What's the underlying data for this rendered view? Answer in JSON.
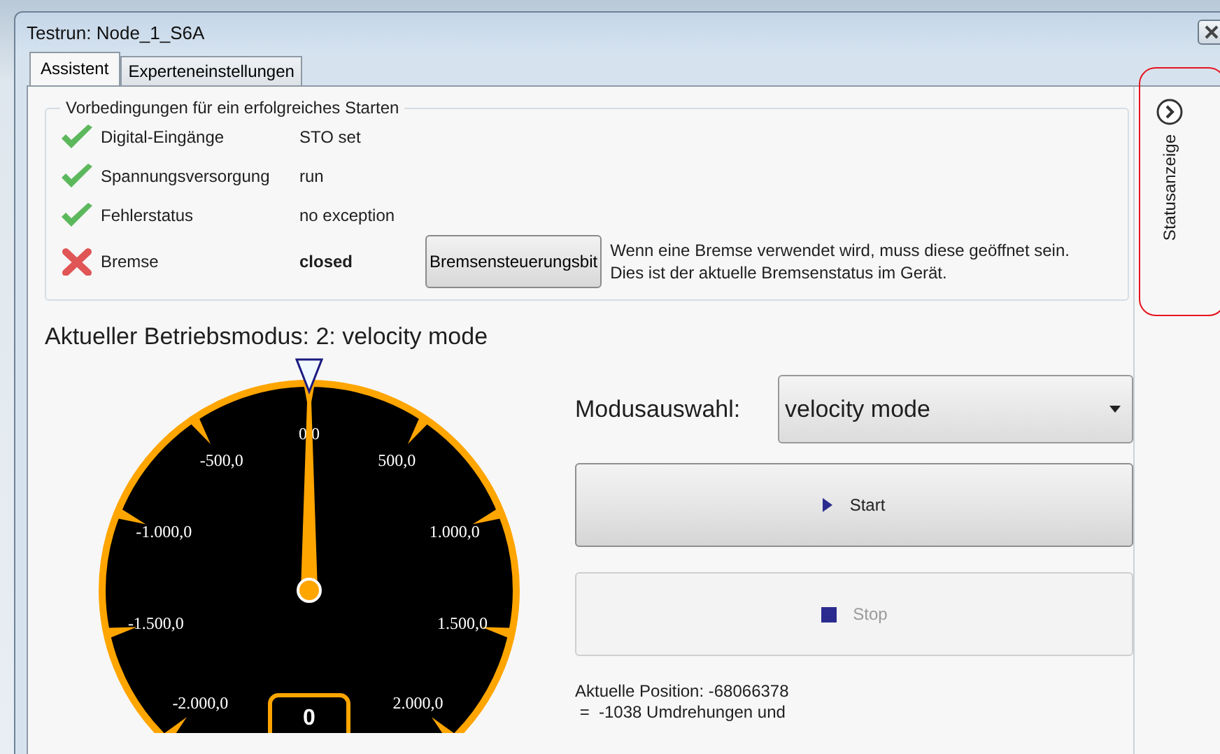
{
  "window": {
    "title": "Testrun: Node_1_S6A"
  },
  "tabs": [
    {
      "label": "Assistent",
      "selected": true
    },
    {
      "label": "Experteneinstellungen",
      "selected": false
    }
  ],
  "preconditions": {
    "title": "Vorbedingungen für ein erfolgreiches Starten",
    "items": [
      {
        "label": "Digital-Eingänge",
        "value": "STO set",
        "ok": true
      },
      {
        "label": "Spannungsversorgung",
        "value": "run",
        "ok": true
      },
      {
        "label": "Fehlerstatus",
        "value": "no exception",
        "ok": true
      },
      {
        "label": "Bremse",
        "value": "closed",
        "ok": false,
        "button": "Bremsensteuerungsbit",
        "note": [
          "Wenn eine Bremse verwendet wird, muss diese geöffnet sein.",
          "Dies ist der aktuelle Bremsenstatus im Gerät."
        ]
      }
    ]
  },
  "mode_title": "Aktueller Betriebsmodus: 2: velocity mode",
  "gauge": {
    "labels": [
      "-2.000,0",
      "-1.500,0",
      "-1.000,0",
      "-500,0",
      "0,0",
      "500,0",
      "1.000,0",
      "1.500,0",
      "2.000,0"
    ],
    "value": "0"
  },
  "mode_select": {
    "label": "Modusauswahl:",
    "value": "velocity mode"
  },
  "buttons": [
    {
      "label": "Start",
      "kind": "start",
      "disabled": false
    },
    {
      "label": "Stop",
      "kind": "stop",
      "disabled": true
    }
  ],
  "position": [
    "Aktuelle Position: -68066378",
    " =  -1038 Umdrehungen und"
  ],
  "side_panel": {
    "label": "Statusanzeige"
  }
}
